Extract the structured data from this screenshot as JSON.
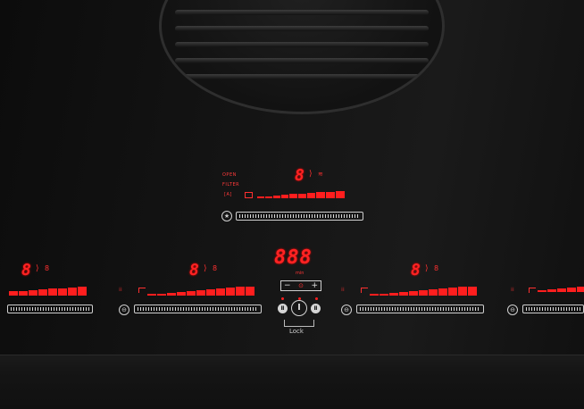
{
  "hood": {
    "labels": [
      "OPEN",
      "FILTER",
      "[A]"
    ],
    "level_digit": "8",
    "extra_icon": "fan-icon"
  },
  "timer": {
    "display": "888",
    "sub_label": "min",
    "minus": "−",
    "plus": "+",
    "clock_icon": "clock-icon"
  },
  "zones": [
    {
      "id": "far-left",
      "digit": "8"
    },
    {
      "id": "left",
      "digit": "8"
    },
    {
      "id": "right",
      "digit": "8"
    },
    {
      "id": "far-right",
      "digit": ""
    }
  ],
  "lock": {
    "label": "Lock"
  },
  "colors": {
    "led_red": "#ff2323",
    "touch_white": "#d0d0d0",
    "glass": "#141414"
  }
}
